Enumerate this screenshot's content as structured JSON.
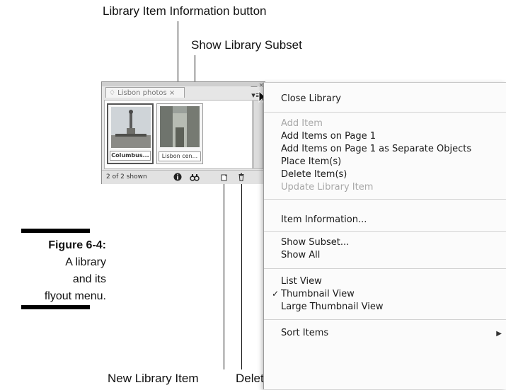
{
  "callouts": {
    "info_button": "Library Item Information button",
    "show_subset": "Show Library Subset",
    "new_item": "New Library Item",
    "delete_item": "Delete Library Item"
  },
  "figure": {
    "label": "Figure 6-4:",
    "caption_lines": [
      "A library",
      "and its",
      "flyout menu."
    ]
  },
  "panel": {
    "tab_label": "♢ Lisbon photos ×",
    "items": [
      {
        "name": "Columbus...",
        "selected": true
      },
      {
        "name": "Lisbon cen...",
        "selected": false
      }
    ],
    "count_text": "2 of 2 shown"
  },
  "menu": {
    "items": [
      {
        "label": "Close Library",
        "enabled": true
      },
      {
        "label": "Add Item",
        "enabled": false
      },
      {
        "label": "Add Items on Page 1",
        "enabled": true
      },
      {
        "label": "Add Items on Page 1 as Separate Objects",
        "enabled": true
      },
      {
        "label": "Place Item(s)",
        "enabled": true
      },
      {
        "label": "Delete Item(s)",
        "enabled": true
      },
      {
        "label": "Update Library Item",
        "enabled": false
      },
      {
        "label": "Item Information...",
        "enabled": true
      },
      {
        "label": "Show Subset...",
        "enabled": true
      },
      {
        "label": "Show All",
        "enabled": true
      },
      {
        "label": "List View",
        "enabled": true
      },
      {
        "label": "Thumbnail View",
        "enabled": true,
        "checked": true
      },
      {
        "label": "Large Thumbnail View",
        "enabled": true
      },
      {
        "label": "Sort Items",
        "enabled": true,
        "submenu": true
      }
    ],
    "check_glyph": "✓",
    "submenu_glyph": "▶"
  }
}
